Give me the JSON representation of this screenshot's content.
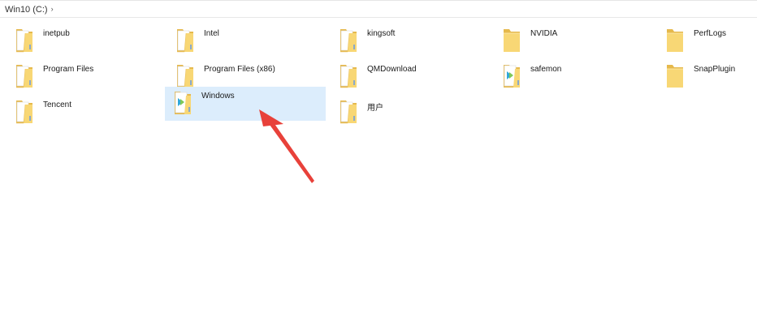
{
  "breadcrumb": {
    "drive": "Win10 (C:)",
    "separator_icon": "chevron-right-icon"
  },
  "folders": [
    {
      "name": "inetpub",
      "icon": "folder-icon",
      "variant": "plain",
      "selected": false
    },
    {
      "name": "Intel",
      "icon": "folder-icon",
      "variant": "plain",
      "selected": false
    },
    {
      "name": "kingsoft",
      "icon": "folder-icon",
      "variant": "plain",
      "selected": false
    },
    {
      "name": "NVIDIA",
      "icon": "folder-icon",
      "variant": "empty",
      "selected": false
    },
    {
      "name": "PerfLogs",
      "icon": "folder-icon",
      "variant": "empty",
      "selected": false
    },
    {
      "name": "Program Files",
      "icon": "folder-icon",
      "variant": "plain",
      "selected": false
    },
    {
      "name": "Program Files (x86)",
      "icon": "folder-icon",
      "variant": "plain",
      "selected": false
    },
    {
      "name": "QMDownload",
      "icon": "folder-icon",
      "variant": "plain",
      "selected": false
    },
    {
      "name": "safemon",
      "icon": "app-folder-icon",
      "variant": "app",
      "selected": false
    },
    {
      "name": "SnapPlugin",
      "icon": "folder-icon",
      "variant": "empty",
      "selected": false
    },
    {
      "name": "Tencent",
      "icon": "folder-icon",
      "variant": "plain",
      "selected": false
    },
    {
      "name": "Windows",
      "icon": "windows-folder-icon",
      "variant": "app",
      "selected": true
    },
    {
      "name": "用户",
      "icon": "folder-icon",
      "variant": "plain",
      "selected": false
    }
  ],
  "annotation": {
    "icon": "red-arrow-annotation",
    "color": "#e8413a"
  },
  "colors": {
    "folder_yellow": "#f8d775",
    "folder_dark": "#e6b94c",
    "selection": "#dcedfc"
  }
}
